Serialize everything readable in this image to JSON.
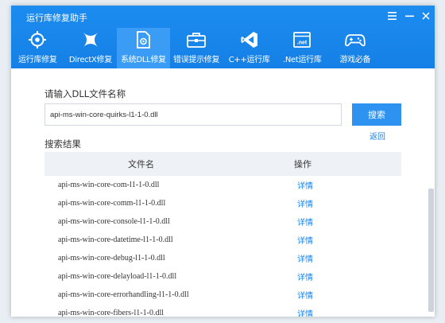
{
  "app": {
    "title": "运行库修复助手"
  },
  "window_controls": [
    "menu-icon",
    "minimize-icon",
    "close-icon"
  ],
  "nav": {
    "items": [
      {
        "label": "运行库修复",
        "icon": "crosshair-icon",
        "active": false
      },
      {
        "label": "DirectX修复",
        "icon": "directx-icon",
        "active": false
      },
      {
        "label": "系统DLL修复",
        "icon": "dll-file-icon",
        "active": true
      },
      {
        "label": "错误提示修复",
        "icon": "toolbox-icon",
        "active": false
      },
      {
        "label": "C++运行库",
        "icon": "visual-studio-icon",
        "active": false
      },
      {
        "label": ".Net运行库",
        "icon": "dotnet-window-icon",
        "active": false
      },
      {
        "label": "游戏必备",
        "icon": "gamepad-icon",
        "active": false
      }
    ]
  },
  "search": {
    "prompt": "请输入DLL文件名称",
    "value": "api-ms-win-core-quirks-l1-1-0.dll",
    "button_label": "搜索",
    "back_label": "返回"
  },
  "results": {
    "label": "搜索结果",
    "columns": {
      "file": "文件名",
      "op": "操作"
    },
    "rows": [
      {
        "file": "api-ms-win-core-com-l1-1-0.dll",
        "op": "详情"
      },
      {
        "file": "api-ms-win-core-comm-l1-1-0.dll",
        "op": "详情"
      },
      {
        "file": "api-ms-win-core-console-l1-1-0.dll",
        "op": "详情"
      },
      {
        "file": "api-ms-win-core-datetime-l1-1-0.dll",
        "op": "详情"
      },
      {
        "file": "api-ms-win-core-debug-l1-1-0.dll",
        "op": "详情"
      },
      {
        "file": "api-ms-win-core-delayload-l1-1-0.dll",
        "op": "详情"
      },
      {
        "file": "api-ms-win-core-errorhandling-l1-1-0.dll",
        "op": "详情"
      },
      {
        "file": "api-ms-win-core-fibers-l1-1-0.dll",
        "op": "详情"
      }
    ]
  },
  "colors": {
    "header": "#1c8cf0",
    "active_tab": "#3a9cf5",
    "link": "#1a82e8",
    "button": "#2e92f0"
  }
}
